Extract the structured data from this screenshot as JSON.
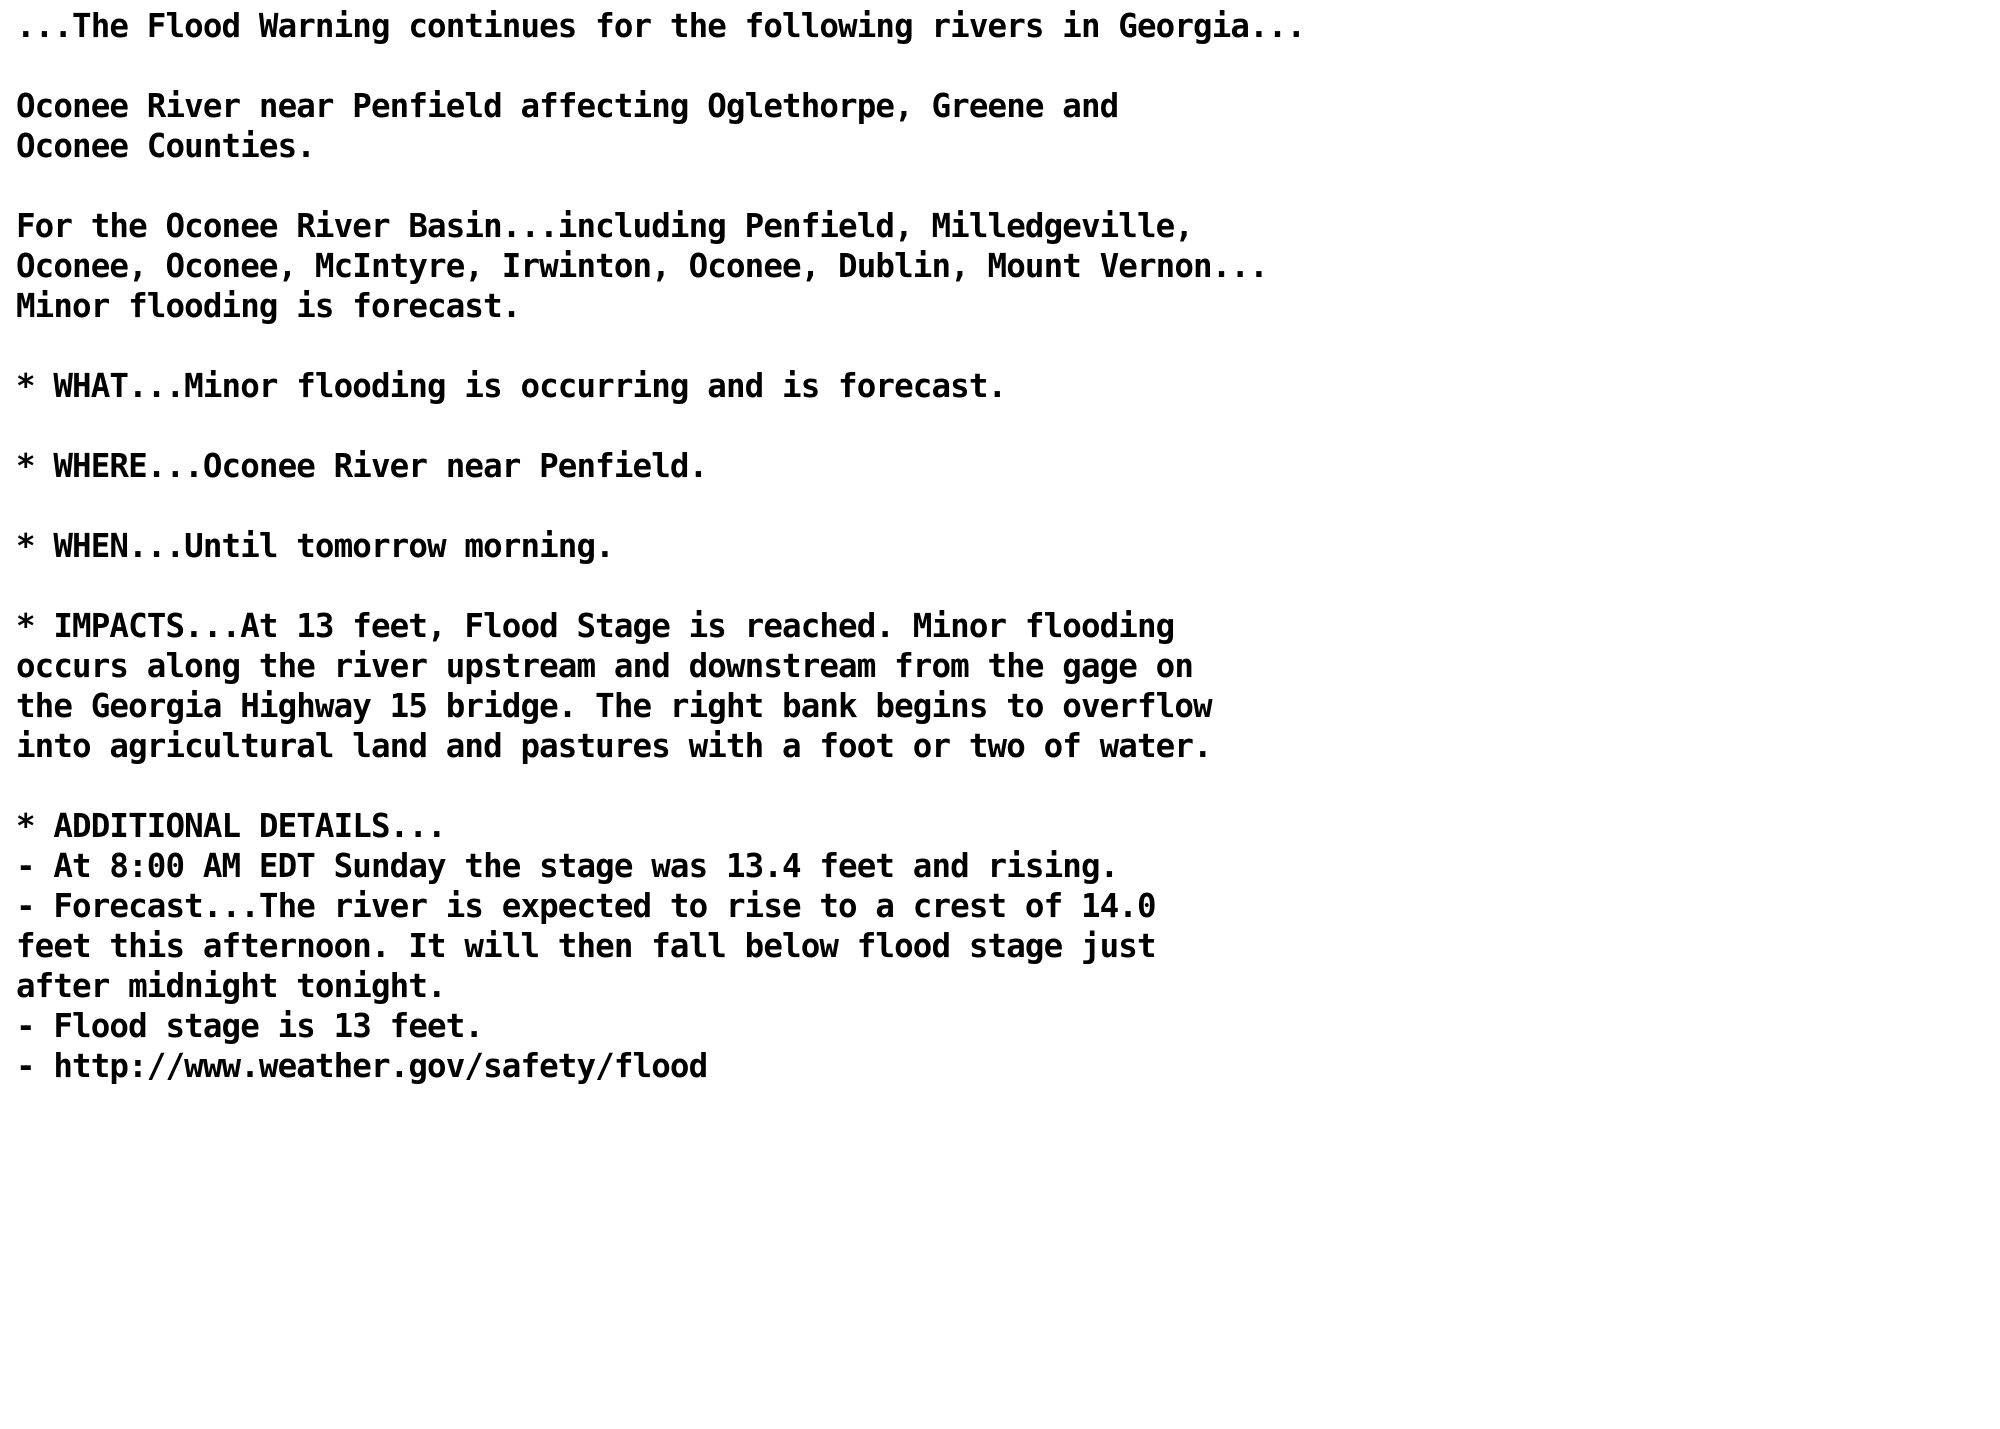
{
  "document": {
    "type": "nws-text-product",
    "product_name": "Flood Warning",
    "background_color": "#ffffff",
    "text_color": "#000000",
    "headline": "...The Flood Warning continues for the following rivers in Georgia...",
    "blocks": [
      {
        "name": "headline",
        "lines": [
          "...The Flood Warning continues for the following rivers in Georgia..."
        ]
      },
      {
        "name": "river-location",
        "lines": [
          "Oconee River near Penfield affecting Oglethorpe, Greene and",
          "Oconee Counties."
        ]
      },
      {
        "name": "basin-summary",
        "lines": [
          "For the Oconee River Basin...including Penfield, Milledgeville,",
          "Oconee, Oconee, McIntyre, Irwinton, Oconee, Dublin, Mount Vernon...",
          "Minor flooding is forecast."
        ]
      },
      {
        "name": "what-bullet",
        "lines": [
          "* WHAT...Minor flooding is occurring and is forecast."
        ]
      },
      {
        "name": "where-bullet",
        "lines": [
          "* WHERE...Oconee River near Penfield."
        ]
      },
      {
        "name": "when-bullet",
        "lines": [
          "* WHEN...Until tomorrow morning."
        ]
      },
      {
        "name": "impacts-bullet",
        "lines": [
          "* IMPACTS...At 13 feet, Flood Stage is reached. Minor flooding",
          "occurs along the river upstream and downstream from the gage on",
          "the Georgia Highway 15 bridge. The right bank begins to overflow",
          "into agricultural land and pastures with a foot or two of water."
        ]
      },
      {
        "name": "additional-details-bullet",
        "lines": [
          "* ADDITIONAL DETAILS...",
          "- At 8:00 AM EDT Sunday the stage was 13.4 feet and rising.",
          "- Forecast...The river is expected to rise to a crest of 14.0",
          "feet this afternoon. It will then fall below flood stage just",
          "after midnight tonight.",
          "- Flood stage is 13 feet.",
          "- http://www.weather.gov/safety/flood"
        ]
      }
    ],
    "values": {
      "river": "Oconee River",
      "gage_location": "near Penfield",
      "counties": [
        "Oglethorpe",
        "Greene",
        "Oconee"
      ],
      "basin": "Oconee River Basin",
      "communities": [
        "Penfield",
        "Milledgeville",
        "Oconee",
        "Oconee",
        "McIntyre",
        "Irwinton",
        "Oconee",
        "Dublin",
        "Mount Vernon"
      ],
      "severity": "Minor",
      "flood_stage_feet": "13",
      "observed_stage_feet": "13.4",
      "observed_time": "8:00 AM EDT Sunday",
      "observed_trend": "rising",
      "forecast_crest_feet": "14.0",
      "forecast_crest_time": "this afternoon",
      "fall_below_flood_stage": "just after midnight tonight",
      "when": "Until tomorrow morning.",
      "highway_bridge": "Georgia Highway 15 bridge",
      "safety_url": "http://www.weather.gov/safety/flood"
    }
  }
}
